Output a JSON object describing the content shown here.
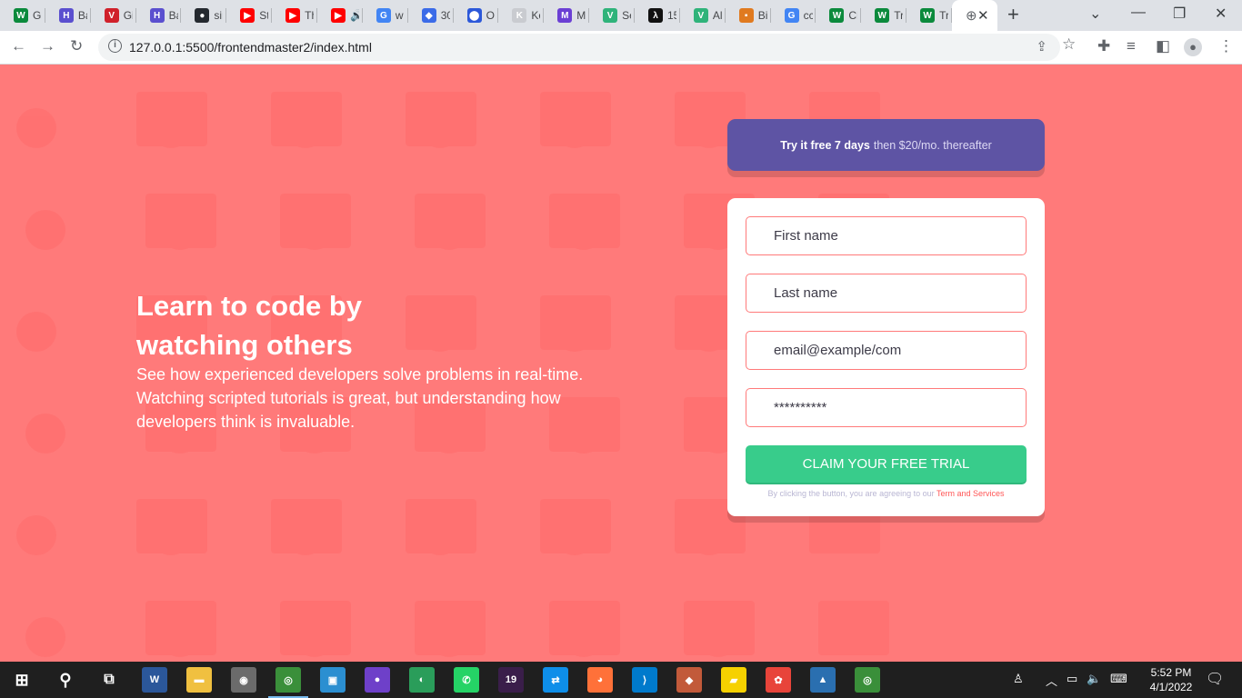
{
  "browser": {
    "tabs": [
      {
        "icon": "w-icon",
        "glyph": "W",
        "color": "#0b8a3c",
        "label": "Gi"
      },
      {
        "icon": "h-icon",
        "glyph": "H",
        "color": "#5a4fcf",
        "label": "Ba"
      },
      {
        "icon": "v-icon",
        "glyph": "V",
        "color": "#d0202a",
        "label": "Gi"
      },
      {
        "icon": "h-icon",
        "glyph": "H",
        "color": "#5a4fcf",
        "label": "Ba"
      },
      {
        "icon": "github-icon",
        "glyph": "●",
        "color": "#24292f",
        "label": "sir"
      },
      {
        "icon": "youtube-icon",
        "glyph": "▶",
        "color": "#ff0000",
        "label": "St"
      },
      {
        "icon": "youtube-icon",
        "glyph": "▶",
        "color": "#ff0000",
        "label": "Th"
      },
      {
        "icon": "youtube-icon",
        "glyph": "▶",
        "color": "#ff0000",
        "label": "🔊"
      },
      {
        "icon": "google-icon",
        "glyph": "G",
        "color": "#4285f4",
        "label": "w"
      },
      {
        "icon": "circle-icon",
        "glyph": "◆",
        "color": "#3b6be8",
        "label": "30"
      },
      {
        "icon": "pin-icon",
        "glyph": "⬤",
        "color": "#2c58d9",
        "label": "O"
      },
      {
        "icon": "k-icon",
        "glyph": "K",
        "color": "#c9cbd0",
        "label": "Ko"
      },
      {
        "icon": "m-icon",
        "glyph": "M",
        "color": "#6b3fd4",
        "label": "M"
      },
      {
        "icon": "v-icon",
        "glyph": "V",
        "color": "#2fb37a",
        "label": "Se"
      },
      {
        "icon": "lambda-icon",
        "glyph": "λ",
        "color": "#111111",
        "label": "15"
      },
      {
        "icon": "v-icon",
        "glyph": "V",
        "color": "#2fb37a",
        "label": "Al"
      },
      {
        "icon": "puzzle-icon",
        "glyph": "▪",
        "color": "#e07a1f",
        "label": "Bi"
      },
      {
        "icon": "google-icon",
        "glyph": "G",
        "color": "#4285f4",
        "label": "cc"
      },
      {
        "icon": "w-icon",
        "glyph": "W",
        "color": "#0b8a3c",
        "label": "Cl"
      },
      {
        "icon": "w-icon",
        "glyph": "W",
        "color": "#0b8a3c",
        "label": "Tr"
      },
      {
        "icon": "w-icon",
        "glyph": "W",
        "color": "#0b8a3c",
        "label": "Tr"
      }
    ],
    "url": "127.0.0.1:5500/frontendmaster2/index.html"
  },
  "hero": {
    "title": "Learn to code by watching others",
    "description": "See how experienced developers solve problems in real-time. Watching scripted tutorials is great, but understanding how developers think is invaluable."
  },
  "promo": {
    "bold": "Try it free 7 days",
    "rest": "then $20/mo. thereafter"
  },
  "form": {
    "first_name_placeholder": "First name",
    "last_name_placeholder": "Last name",
    "email_placeholder": "email@example/com",
    "password_placeholder": "**********",
    "submit_label": "CLAIM YOUR FREE TRIAL",
    "terms_text": "By clicking the button, you are agreeing to our",
    "terms_link": "Term and Services"
  },
  "taskbar": {
    "time": "5:52 PM",
    "date": "4/1/2022",
    "apps": [
      {
        "icon": "word-icon",
        "glyph": "W",
        "color": "#2b579a"
      },
      {
        "icon": "folder-icon",
        "glyph": "▬",
        "color": "#f0c040"
      },
      {
        "icon": "camera-icon",
        "glyph": "◉",
        "color": "#6b6b6b"
      },
      {
        "icon": "chrome-icon",
        "glyph": "◎",
        "color": "#3a8f3a"
      },
      {
        "icon": "app-icon",
        "glyph": "▣",
        "color": "#2b8fd1"
      },
      {
        "icon": "github-icon",
        "glyph": "●",
        "color": "#6e40c9"
      },
      {
        "icon": "app2-icon",
        "glyph": "◐",
        "color": "#2a9d5a"
      },
      {
        "icon": "whatsapp-icon",
        "glyph": "✆",
        "color": "#25d366"
      },
      {
        "icon": "app19-icon",
        "glyph": "19",
        "color": "#3a1e4a"
      },
      {
        "icon": "teamviewer-icon",
        "glyph": "⇄",
        "color": "#0e8ee9"
      },
      {
        "icon": "firefox-icon",
        "glyph": "◕",
        "color": "#ff7139"
      },
      {
        "icon": "vscode-icon",
        "glyph": "⟩",
        "color": "#007acc"
      },
      {
        "icon": "git-icon",
        "glyph": "◆",
        "color": "#c25a3a"
      },
      {
        "icon": "sticky-notes-icon",
        "glyph": "▰",
        "color": "#f6d100"
      },
      {
        "icon": "app3-icon",
        "glyph": "✿",
        "color": "#e8443a"
      },
      {
        "icon": "photos-icon",
        "glyph": "▲",
        "color": "#2a6fb0"
      },
      {
        "icon": "chrome-icon",
        "glyph": "◎",
        "color": "#3a8f3a"
      }
    ]
  }
}
